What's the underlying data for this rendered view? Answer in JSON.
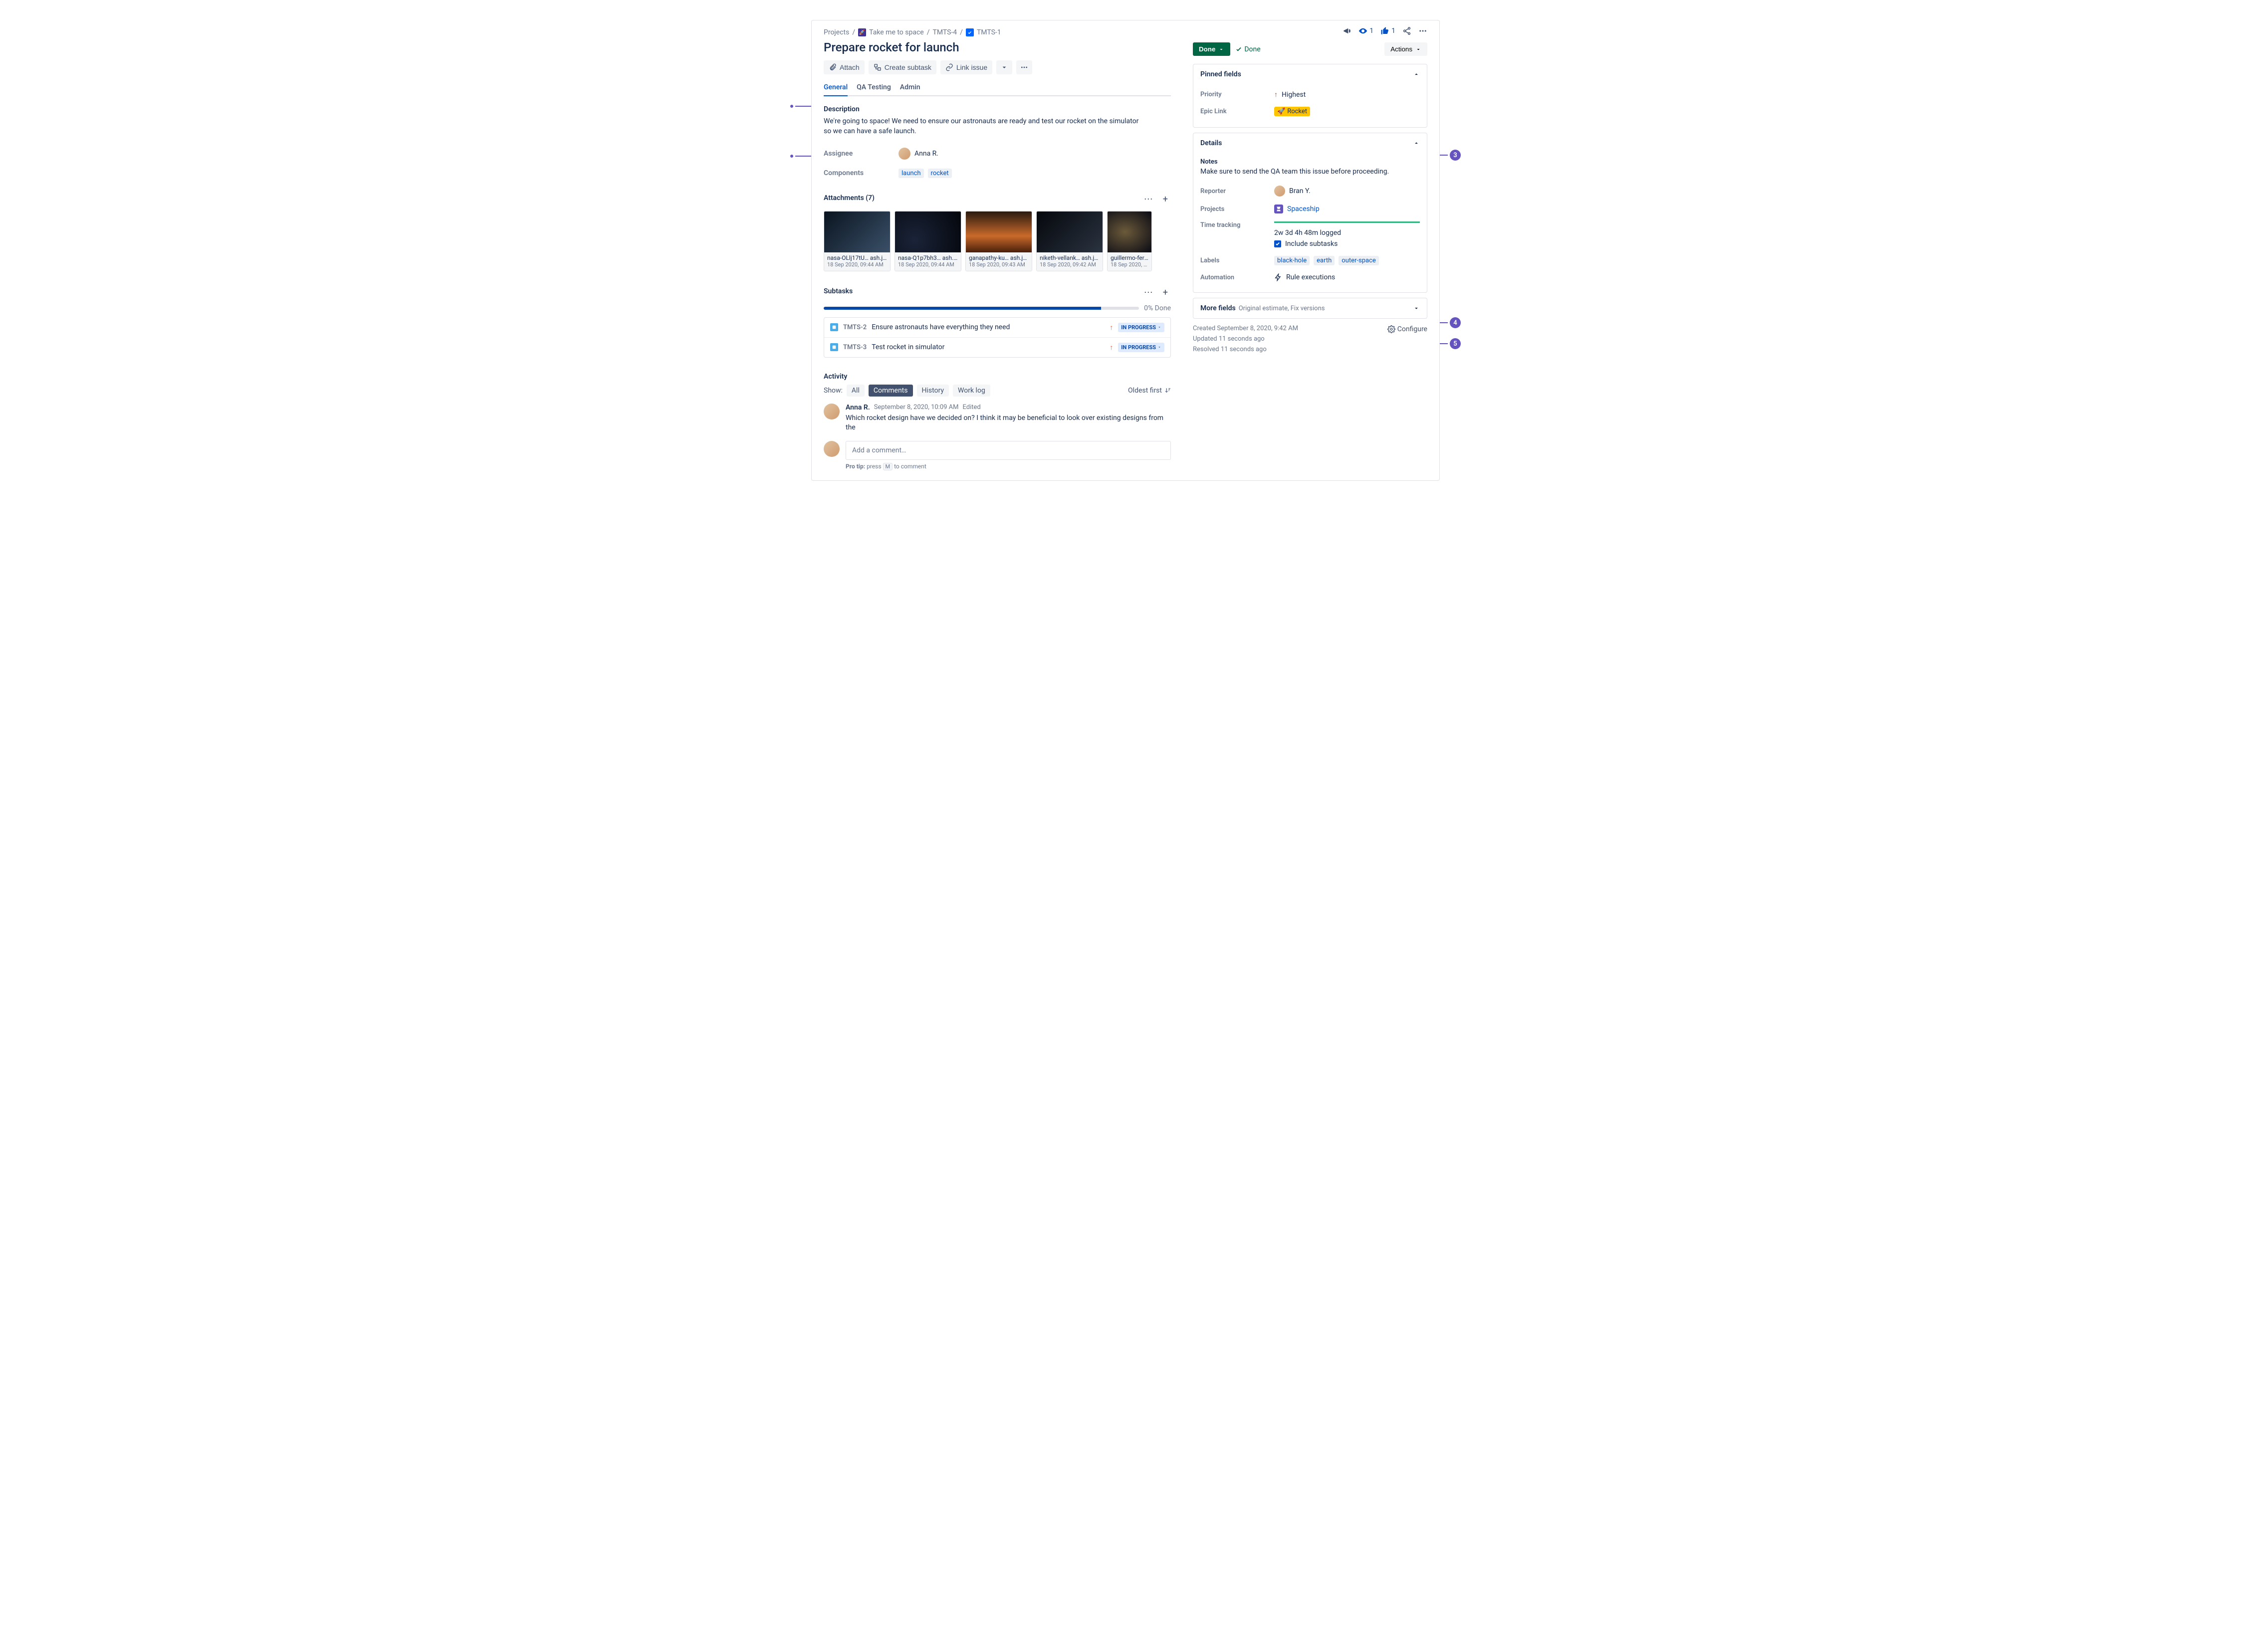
{
  "breadcrumbs": {
    "projects": "Projects",
    "space": "Take me to space",
    "parent": "TMTS-4",
    "key": "TMTS-1"
  },
  "title": "Prepare rocket for launch",
  "actions": {
    "attach": "Attach",
    "create_subtask": "Create subtask",
    "link_issue": "Link issue"
  },
  "tabs": [
    "General",
    "QA Testing",
    "Admin"
  ],
  "description": {
    "heading": "Description",
    "body": "We're going to space! We need to ensure our astronauts are ready and test our rocket on the simulator so we can have a safe launch."
  },
  "fields": {
    "assignee_label": "Assignee",
    "assignee_name": "Anna R.",
    "components_label": "Components",
    "components": [
      "launch",
      "rocket"
    ]
  },
  "attachments": {
    "heading": "Attachments (7)",
    "items": [
      {
        "name": "nasa-OLlj17tU… ash.jpg",
        "date": "18 Sep 2020, 09:44 AM"
      },
      {
        "name": "nasa-Q1p7bh3… ash.jpg",
        "date": "18 Sep 2020, 09:44 AM"
      },
      {
        "name": "ganapathy-ku… ash.jpg",
        "date": "18 Sep 2020, 09:43 AM"
      },
      {
        "name": "niketh-vellank… ash.jpg",
        "date": "18 Sep 2020, 09:42 AM"
      },
      {
        "name": "guillermo-ferl… a…",
        "date": "18 Sep 2020, 09:…"
      }
    ]
  },
  "subtasks": {
    "heading": "Subtasks",
    "pct": "0% Done",
    "items": [
      {
        "key": "TMTS-2",
        "title": "Ensure astronauts have everything they need",
        "status": "IN PROGRESS"
      },
      {
        "key": "TMTS-3",
        "title": "Test rocket in simulator",
        "status": "IN PROGRESS"
      }
    ]
  },
  "activity": {
    "heading": "Activity",
    "show_label": "Show:",
    "filters": [
      "All",
      "Comments",
      "History",
      "Work log"
    ],
    "sort": "Oldest first",
    "comment": {
      "author": "Anna R.",
      "date": "September 8, 2020, 10:09 AM",
      "edited": "Edited",
      "text": "Which rocket design have we decided on? I think it may be beneficial to look over existing designs from the"
    },
    "add_placeholder": "Add a comment…",
    "protip_a": "Pro tip:",
    "protip_b": "press",
    "protip_key": "M",
    "protip_c": "to comment"
  },
  "right": {
    "watchers": "1",
    "likes": "1",
    "status_done": "Done",
    "done_check": "Done",
    "actions_btn": "Actions",
    "pinned": {
      "title": "Pinned fields",
      "priority_label": "Priority",
      "priority_value": "Highest",
      "epic_label": "Epic Link",
      "epic_value": "Rocket"
    },
    "details": {
      "title": "Details",
      "notes_label": "Notes",
      "notes_text": "Make sure to send the QA team this issue before proceeding.",
      "reporter_label": "Reporter",
      "reporter_value": "Bran Y.",
      "projects_label": "Projects",
      "projects_value": "Spaceship",
      "tt_label": "Time tracking",
      "tt_value": "2w 3d 4h 48m logged",
      "tt_include": "Include subtasks",
      "labels_label": "Labels",
      "labels": [
        "black-hole",
        "earth",
        "outer-space"
      ],
      "automation_label": "Automation",
      "automation_value": "Rule executions"
    },
    "more_fields": {
      "title": "More fields",
      "hint": "Original estimate, Fix versions"
    },
    "meta": {
      "created": "Created September 8, 2020, 9:42 AM",
      "updated": "Updated 11 seconds ago",
      "resolved": "Resolved 11 seconds ago",
      "configure": "Configure"
    }
  }
}
